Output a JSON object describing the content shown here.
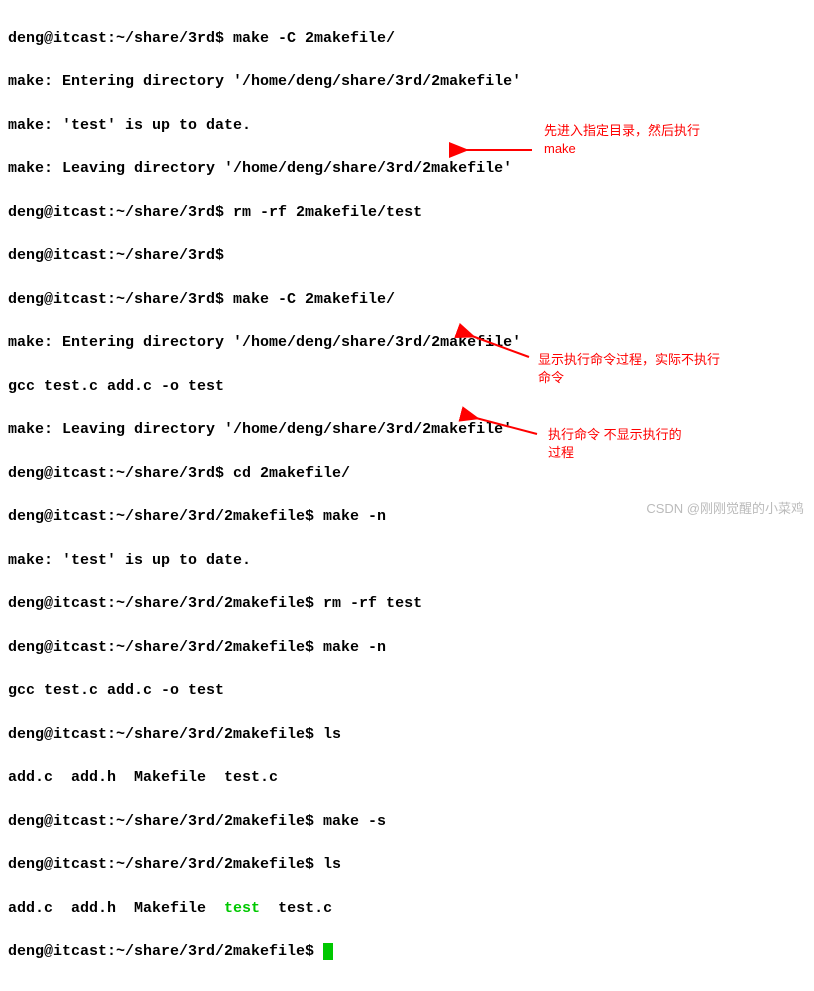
{
  "terminal": {
    "lines": [
      {
        "type": "plain",
        "text": "deng@itcast:~/share/3rd$ make -C 2makefile/"
      },
      {
        "type": "plain",
        "text": "make: Entering directory '/home/deng/share/3rd/2makefile'"
      },
      {
        "type": "plain",
        "text": "make: 'test' is up to date."
      },
      {
        "type": "plain",
        "text": "make: Leaving directory '/home/deng/share/3rd/2makefile'"
      },
      {
        "type": "plain",
        "text": "deng@itcast:~/share/3rd$ rm -rf 2makefile/test"
      },
      {
        "type": "plain",
        "text": "deng@itcast:~/share/3rd$"
      },
      {
        "type": "plain",
        "text": "deng@itcast:~/share/3rd$ make -C 2makefile/"
      },
      {
        "type": "plain",
        "text": "make: Entering directory '/home/deng/share/3rd/2makefile'"
      },
      {
        "type": "plain",
        "text": "gcc test.c add.c -o test"
      },
      {
        "type": "plain",
        "text": "make: Leaving directory '/home/deng/share/3rd/2makefile'"
      },
      {
        "type": "plain",
        "text": "deng@itcast:~/share/3rd$ cd 2makefile/"
      },
      {
        "type": "plain",
        "text": "deng@itcast:~/share/3rd/2makefile$ make -n"
      },
      {
        "type": "plain",
        "text": "make: 'test' is up to date."
      },
      {
        "type": "plain",
        "text": "deng@itcast:~/share/3rd/2makefile$ rm -rf test"
      },
      {
        "type": "plain",
        "text": "deng@itcast:~/share/3rd/2makefile$ make -n"
      },
      {
        "type": "plain",
        "text": "gcc test.c add.c -o test"
      },
      {
        "type": "plain",
        "text": "deng@itcast:~/share/3rd/2makefile$ ls"
      },
      {
        "type": "plain",
        "text": "add.c  add.h  Makefile  test.c"
      },
      {
        "type": "plain",
        "text": "deng@itcast:~/share/3rd/2makefile$ make -s"
      },
      {
        "type": "plain",
        "text": "deng@itcast:~/share/3rd/2makefile$ ls"
      },
      {
        "type": "ls_green",
        "prefix": "add.c  add.h  Makefile  ",
        "green": "test",
        "suffix": "  test.c"
      },
      {
        "type": "cursor",
        "text": "deng@itcast:~/share/3rd/2makefile$ "
      }
    ]
  },
  "annotations": {
    "a1": {
      "line1": "先进入指定目录，然后执行",
      "line2": "make"
    },
    "a2": {
      "line1": "显示执行命令过程，实际不执行",
      "line2": "命令"
    },
    "a3": {
      "line1": "执行命令 不显示执行的",
      "line2": "过程"
    }
  },
  "watermark": "CSDN @刚刚觉醒的小菜鸡"
}
